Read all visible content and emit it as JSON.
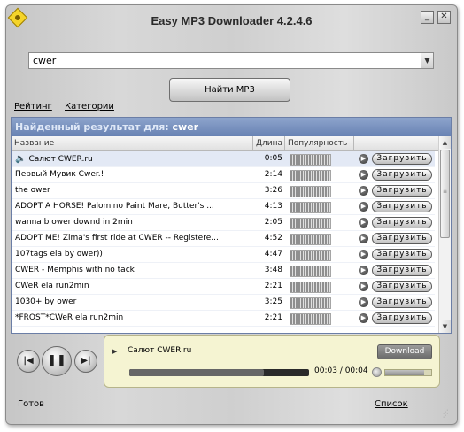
{
  "window": {
    "title": "Easy MP3 Downloader  4.2.4.6",
    "minimize_label": "_",
    "close_label": "✕"
  },
  "search": {
    "value": "cwer",
    "find_button": "Найти MP3"
  },
  "menu": {
    "rating": "Рейтинг",
    "categories": "Категории"
  },
  "results": {
    "header_label": "Найденный результат для:",
    "header_query": "cwer",
    "columns": {
      "name": "Название",
      "length": "Длина",
      "popularity": "Популярность"
    },
    "download_label": "Загрузить",
    "rows": [
      {
        "title": "Салют CWER.ru",
        "length": "0:05",
        "popularity": 0.9
      },
      {
        "title": "Первый Мувик Cwer.!",
        "length": "2:14",
        "popularity": 0.9
      },
      {
        "title": "the ower",
        "length": "3:26",
        "popularity": 0.9
      },
      {
        "title": "ADOPT A HORSE! Palomino Paint Mare, Butter's ...",
        "length": "4:13",
        "popularity": 0.9
      },
      {
        "title": "wanna b ower downd in 2min",
        "length": "2:05",
        "popularity": 0.9
      },
      {
        "title": "ADOPT ME! Zima's first ride at CWER -- Registere...",
        "length": "4:52",
        "popularity": 0.9
      },
      {
        "title": "107tags ela by ower))",
        "length": "4:47",
        "popularity": 0.9
      },
      {
        "title": "CWER - Memphis with no tack",
        "length": "3:48",
        "popularity": 0.9
      },
      {
        "title": "CWeR ela run2min",
        "length": "2:21",
        "popularity": 0.9
      },
      {
        "title": "1030+ by ower",
        "length": "3:25",
        "popularity": 0.9
      },
      {
        "title": "*FROST*CWeR ela run2min",
        "length": "2:21",
        "popularity": 0.9
      }
    ]
  },
  "player": {
    "now_playing": "Салют CWER.ru",
    "download_button": "Download",
    "time": "00:03 / 00:04",
    "progress": 0.75,
    "volume": 0.85,
    "prev_icon": "prev-track-icon",
    "pause_icon": "pause-icon",
    "next_icon": "next-track-icon"
  },
  "status": {
    "text": "Готов",
    "list_link": "Список"
  }
}
